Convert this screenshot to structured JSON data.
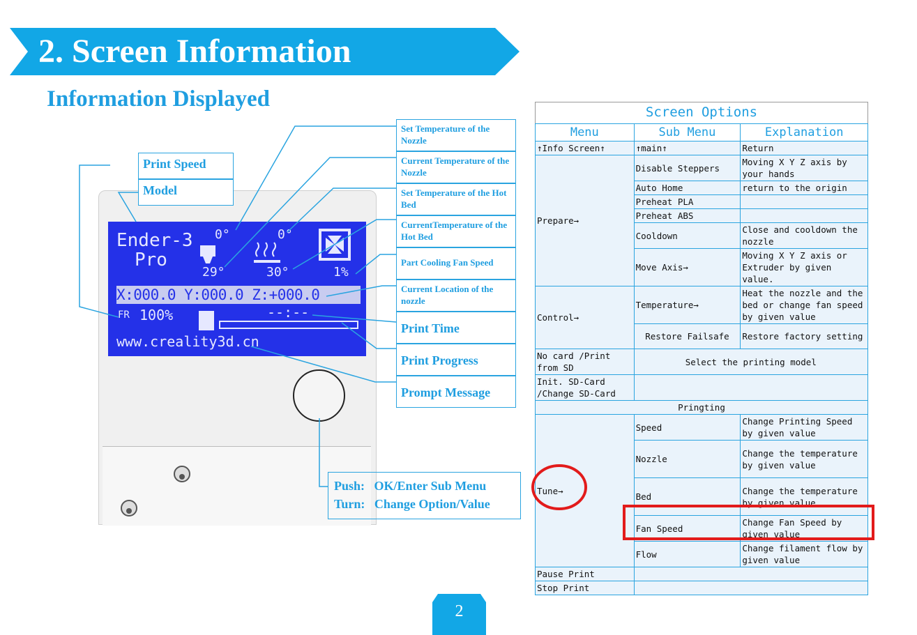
{
  "header": {
    "title": "2. Screen Information",
    "subtitle": "Information Displayed"
  },
  "colors": {
    "accent": "#1f9ee0",
    "banner": "#12a7e6",
    "lcd": "#2431e8",
    "highlight": "#e21b1b"
  },
  "labels": {
    "print_speed": "Print Speed",
    "model": "Model",
    "callouts": [
      "Set Temperature of the Nozzle",
      "Current Temperature of the Nozzle",
      "Set Temperature of the Hot Bed",
      "CurrentTemperature of the Hot Bed",
      "Part Cooling Fan Speed",
      "Current Location of the nozzle",
      "Print Time",
      "Print Progress",
      "Prompt Message"
    ],
    "push": "Push:   OK/Enter Sub Menu",
    "turn": "Turn:   Change Option/Value"
  },
  "lcd": {
    "model_line1": "Ender-3",
    "model_line2": "Pro",
    "nozzle_set": "0°",
    "bed_set": "0°",
    "nozzle_cur": "29°",
    "bed_cur": "30°",
    "fan": "1%",
    "position": "X:000.0 Y:000.0 Z:+000.0",
    "speed_icon": "FR",
    "speed": "100%",
    "time": "--:--",
    "message": "www.creality3d.cn"
  },
  "table": {
    "title": "Screen Options",
    "headers": [
      "Menu",
      "Sub Menu",
      "Explanation"
    ],
    "rows": {
      "info": [
        "↑Info Screen↑",
        "↑main↑",
        "Return"
      ],
      "prepare": "Prepare→",
      "disable": [
        "Disable Steppers",
        "Moving X Y Z axis by your hands"
      ],
      "autohome": [
        "Auto Home",
        "return to the origin"
      ],
      "pla": "Preheat PLA",
      "abs": "Preheat ABS",
      "cooldown": [
        "Cooldown",
        "Close and cooldown the nozzle"
      ],
      "moveaxis": [
        "Move Axis→",
        "Moving X Y Z axis or Extruder by given value."
      ],
      "control": "Control→",
      "temperature": [
        "Temperature→",
        "Heat the nozzle and the bed or change fan speed by given value"
      ],
      "restore": [
        "Restore Failsafe",
        "Restore factory setting"
      ],
      "nocard": [
        "No card /Print from SD",
        "Select the printing model"
      ],
      "initsd": "Init. SD-Card /Change SD-Card",
      "printing": "Pringting",
      "tune": "Tune→",
      "speed": [
        "Speed",
        "Change Printing Speed by given value"
      ],
      "nozzle": [
        "Nozzle",
        "Change the temperature by given value"
      ],
      "bed": [
        "Bed",
        "Change the temperature by given value"
      ],
      "fanspeed": [
        "Fan Speed",
        "Change Fan Speed by given value"
      ],
      "flow": [
        "Flow",
        "Change filament flow by given value"
      ],
      "pause": "Pause Print",
      "stop": "Stop Print"
    }
  },
  "page_number": "2"
}
